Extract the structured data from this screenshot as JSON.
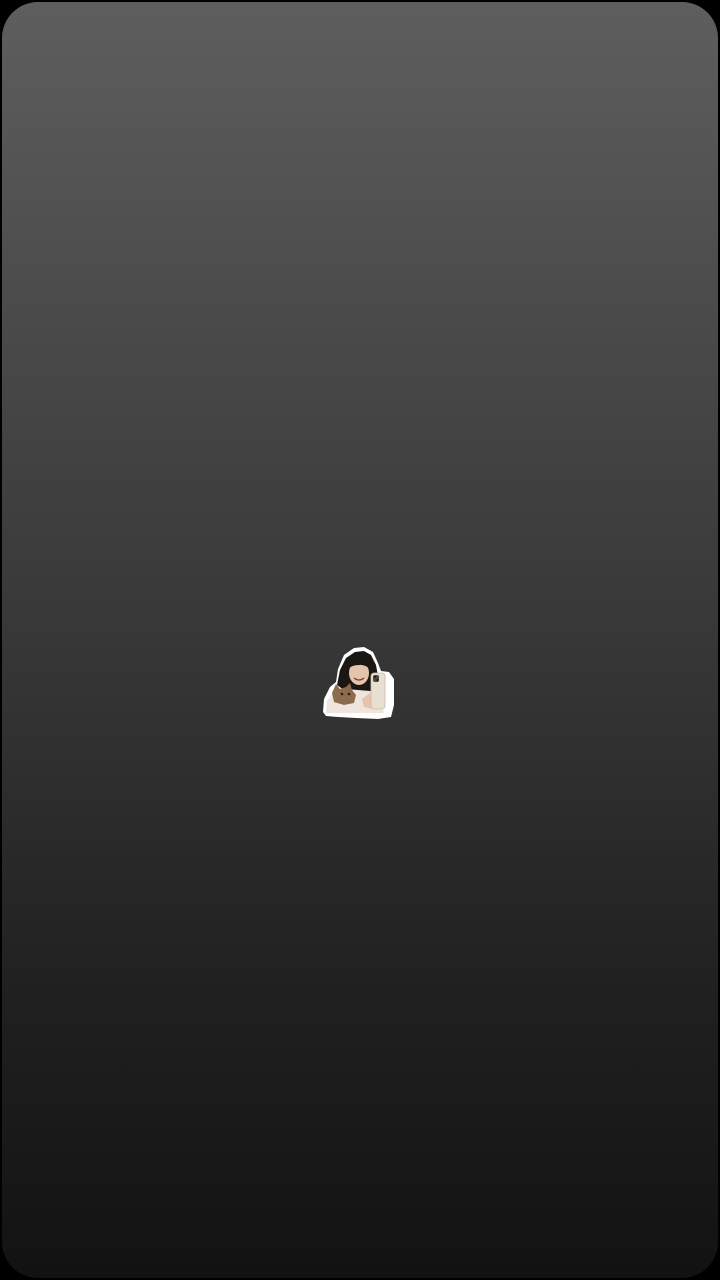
{
  "screen": {
    "background": "dark-gradient"
  },
  "sticker": {
    "kind": "person-selfie-with-cat-sticker",
    "colors": {
      "outline": "#ffffff",
      "hair": "#1b1715",
      "skin": "#e6c3ad",
      "shirt": "#efe5de",
      "cat": "#8d6c4e",
      "phone": "#e7dfcf"
    }
  }
}
